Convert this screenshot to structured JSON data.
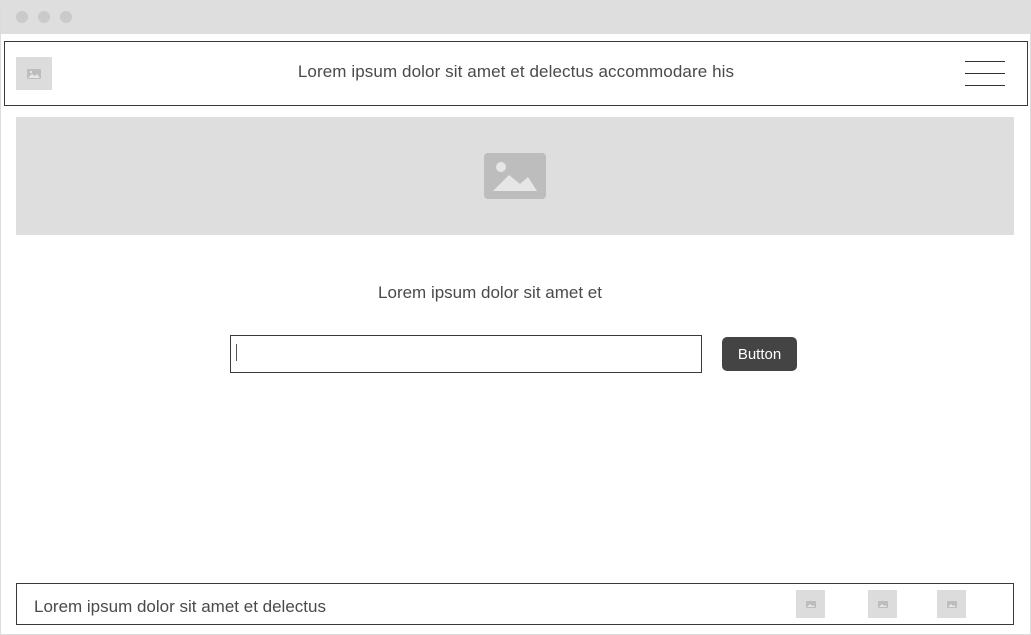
{
  "window": {
    "controls": [
      "close-dot",
      "minimize-dot",
      "maximize-dot"
    ]
  },
  "header": {
    "logo_icon": "image-placeholder-icon",
    "title": "Lorem ipsum dolor sit amet et delectus accommodare his",
    "menu_icon": "hamburger-menu-icon"
  },
  "hero": {
    "icon": "image-placeholder-icon"
  },
  "main": {
    "subtitle": "Lorem ipsum dolor sit amet et",
    "input": {
      "value": "",
      "placeholder": ""
    },
    "button_label": "Button"
  },
  "footer": {
    "text": "Lorem ipsum dolor sit amet et delectus",
    "social_icons": [
      "image-placeholder-icon",
      "image-placeholder-icon",
      "image-placeholder-icon"
    ]
  },
  "colors": {
    "placeholder_bg": "#dedede",
    "button_bg": "#444444",
    "text": "#4a4a4a",
    "border": "#3a3a3a"
  }
}
